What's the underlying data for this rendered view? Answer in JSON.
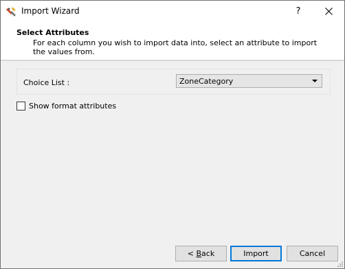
{
  "window": {
    "title": "Import Wizard",
    "help_glyph": "?",
    "icon": "import-wizard-app-icon"
  },
  "header": {
    "title": "Select Attributes",
    "description": "For each column you wish to import data into, select an attribute to import the values from."
  },
  "choice_list": {
    "label": "Choice List :",
    "selected": "ZoneCategory"
  },
  "show_format": {
    "label": "Show format attributes",
    "checked": false
  },
  "buttons": {
    "back_prefix": "< ",
    "back_mnemonic": "B",
    "back_rest": "ack",
    "import": "Import",
    "cancel": "Cancel"
  },
  "colors": {
    "accent": "#0078d7",
    "dialog_bg": "#f0f0f0",
    "header_bg": "#ffffff"
  }
}
